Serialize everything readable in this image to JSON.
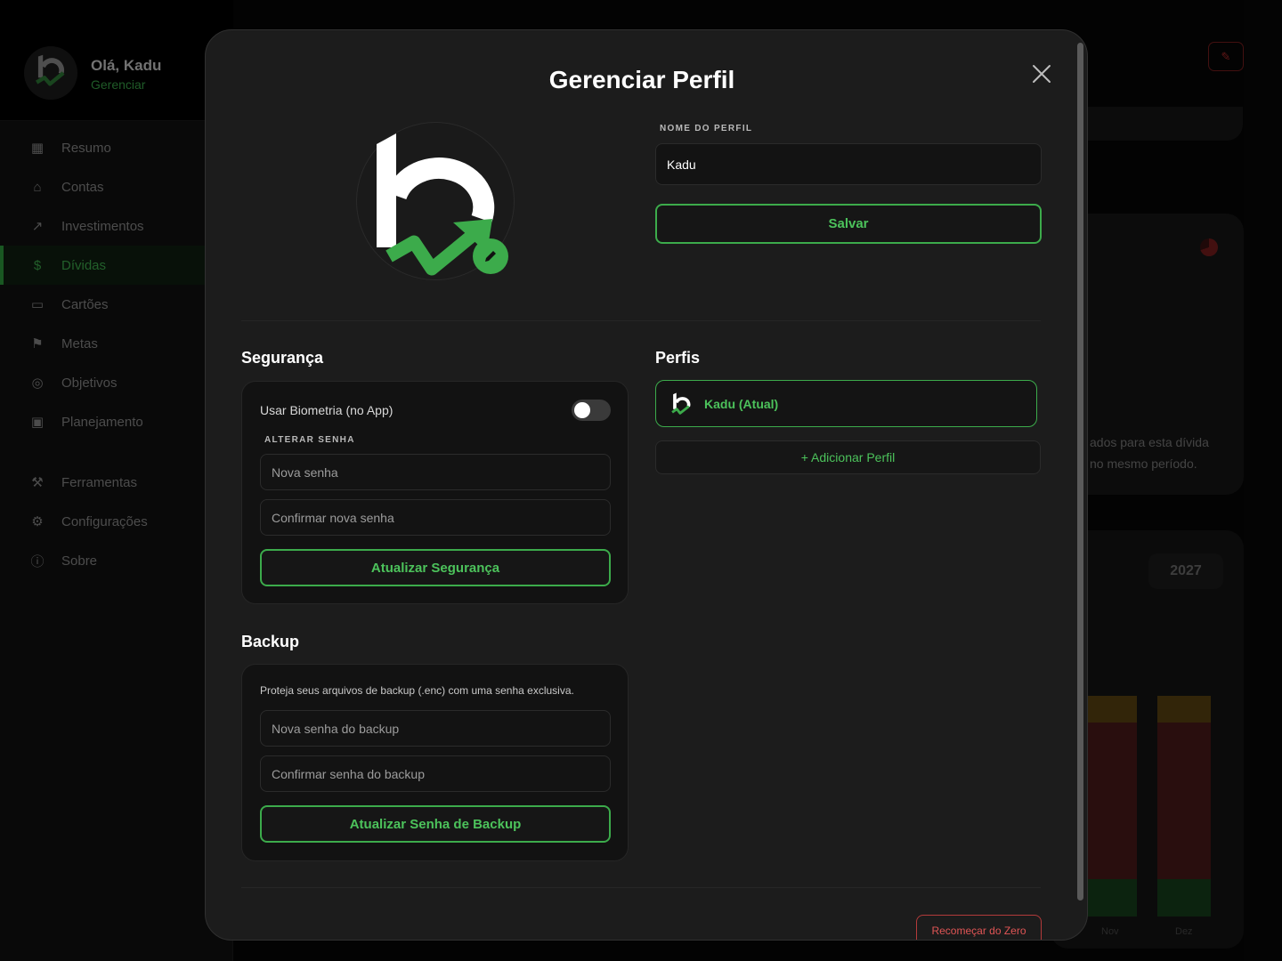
{
  "sidebar": {
    "greeting": "Olá, Kadu",
    "manage_link": "Gerenciar",
    "items": [
      {
        "label": "Resumo",
        "icon": "grid-icon"
      },
      {
        "label": "Contas",
        "icon": "bank-icon"
      },
      {
        "label": "Investimentos",
        "icon": "trend-icon"
      },
      {
        "label": "Dívidas",
        "icon": "dollar-icon",
        "active": true
      },
      {
        "label": "Cartões",
        "icon": "card-icon"
      },
      {
        "label": "Metas",
        "icon": "flag-icon"
      },
      {
        "label": "Objetivos",
        "icon": "target-icon"
      },
      {
        "label": "Planejamento",
        "icon": "calendar-icon"
      },
      {
        "label": "Ferramentas",
        "icon": "wrench-icon"
      },
      {
        "label": "Configurações",
        "icon": "gear-icon"
      },
      {
        "label": "Sobre",
        "icon": "info-icon"
      }
    ]
  },
  "background": {
    "card_text_1": "ados para esta dívida",
    "card_text_2": "no mesmo período.",
    "year": "2027",
    "chart_labels": [
      "Nov",
      "Dez"
    ]
  },
  "modal": {
    "title": "Gerenciar Perfil",
    "profile_name_label": "NOME DO PERFIL",
    "profile_name_value": "Kadu",
    "save_label": "Salvar",
    "security": {
      "title": "Segurança",
      "biometric_label": "Usar Biometria (no App)",
      "biometric_enabled": false,
      "change_password_label": "ALTERAR SENHA",
      "new_password_placeholder": "Nova senha",
      "confirm_password_placeholder": "Confirmar nova senha",
      "update_label": "Atualizar Segurança"
    },
    "backup": {
      "title": "Backup",
      "description": "Proteja seus arquivos de backup (.enc) com uma senha exclusiva.",
      "new_password_placeholder": "Nova senha do backup",
      "confirm_password_placeholder": "Confirmar senha do backup",
      "update_label": "Atualizar Senha de Backup"
    },
    "profiles": {
      "title": "Perfis",
      "current_profile": "Kadu (Atual)",
      "add_label": "+ Adicionar Perfil"
    },
    "reset_label": "Recomeçar do Zero"
  },
  "colors": {
    "accent": "#3cab4b",
    "danger": "#e05555",
    "modal_bg": "#1c1c1c"
  }
}
